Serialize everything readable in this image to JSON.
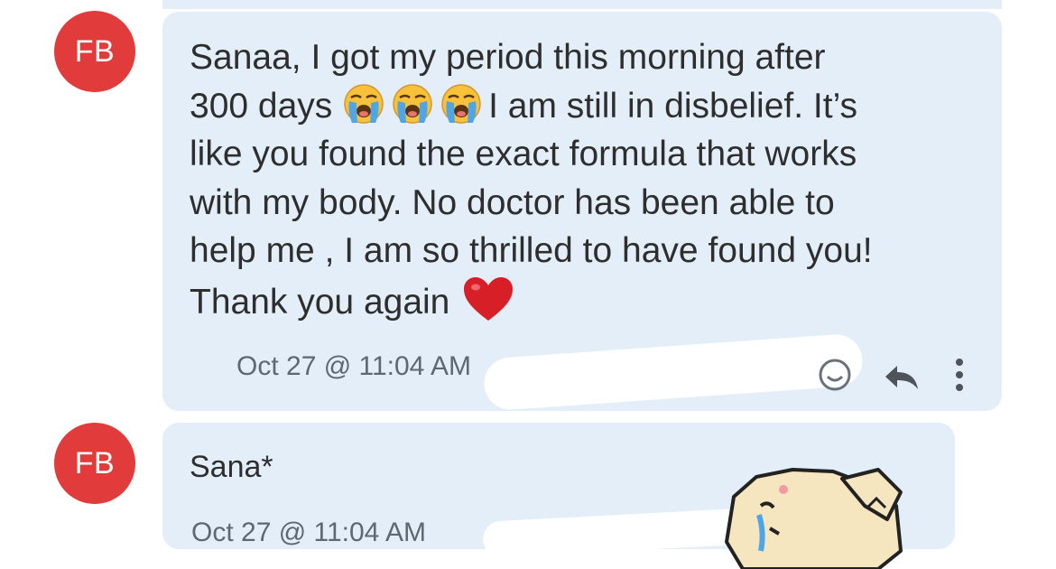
{
  "messages": [
    {
      "avatar": "FB",
      "text_line1": "Sanaa, I got my period this morning after",
      "text_line2_prefix": "300 days ",
      "text_line2_emoji": "loudly-crying-face-emoji",
      "text_line2_suffix": "I am still in disbelief. It’s",
      "text_line3": "like you found the exact formula that works",
      "text_line4": "with my body. No doctor has been able to",
      "text_line5": "help me , I am so thrilled to have found you!",
      "text_line6": "Thank you again",
      "text_end_emoji": "red-heart-emoji",
      "timestamp": "Oct 27 @ 11:04 AM",
      "icons": [
        "add-reaction-icon",
        "reply-icon",
        "more-vertical-icon"
      ]
    },
    {
      "avatar": "FB",
      "text": "Sana*",
      "timestamp": "Oct 27 @ 11:04 AM",
      "sticker": "crying-dog-sticker"
    }
  ],
  "colors": {
    "avatar_bg": "#e13b3b",
    "bubble_bg": "#e3eef8",
    "text": "#2e2e2e",
    "meta_text": "#5f6770",
    "heart": "#d61f26"
  }
}
